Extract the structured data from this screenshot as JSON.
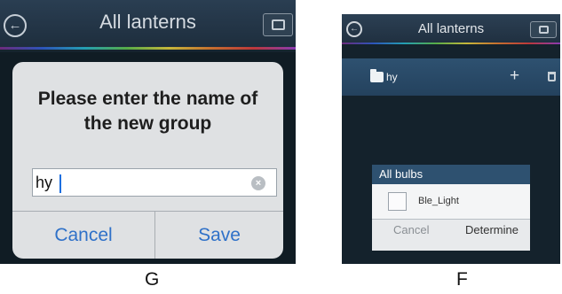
{
  "panel_g": {
    "header_title": "All lanterns",
    "dialog_title": "Please enter the name of the new group",
    "input_value": "hy",
    "cancel_label": "Cancel",
    "save_label": "Save",
    "caption": "G"
  },
  "panel_f": {
    "header_title": "All lanterns",
    "group_name": "hy",
    "add_label": "+",
    "dialog_header": "All bulbs",
    "bulb_item": "Ble_Light",
    "cancel_label": "Cancel",
    "determine_label": "Determine",
    "caption": "F"
  },
  "icons": {
    "back": "back-arrow-circle-icon",
    "folder": "folder-icon",
    "clear": "clear-x-circle-icon",
    "add": "plus-icon",
    "delete": "trash-icon"
  },
  "colors": {
    "accent_blue": "#2f71c8",
    "header_dark": "#1d2d3c",
    "group_row": "#2e5170"
  }
}
